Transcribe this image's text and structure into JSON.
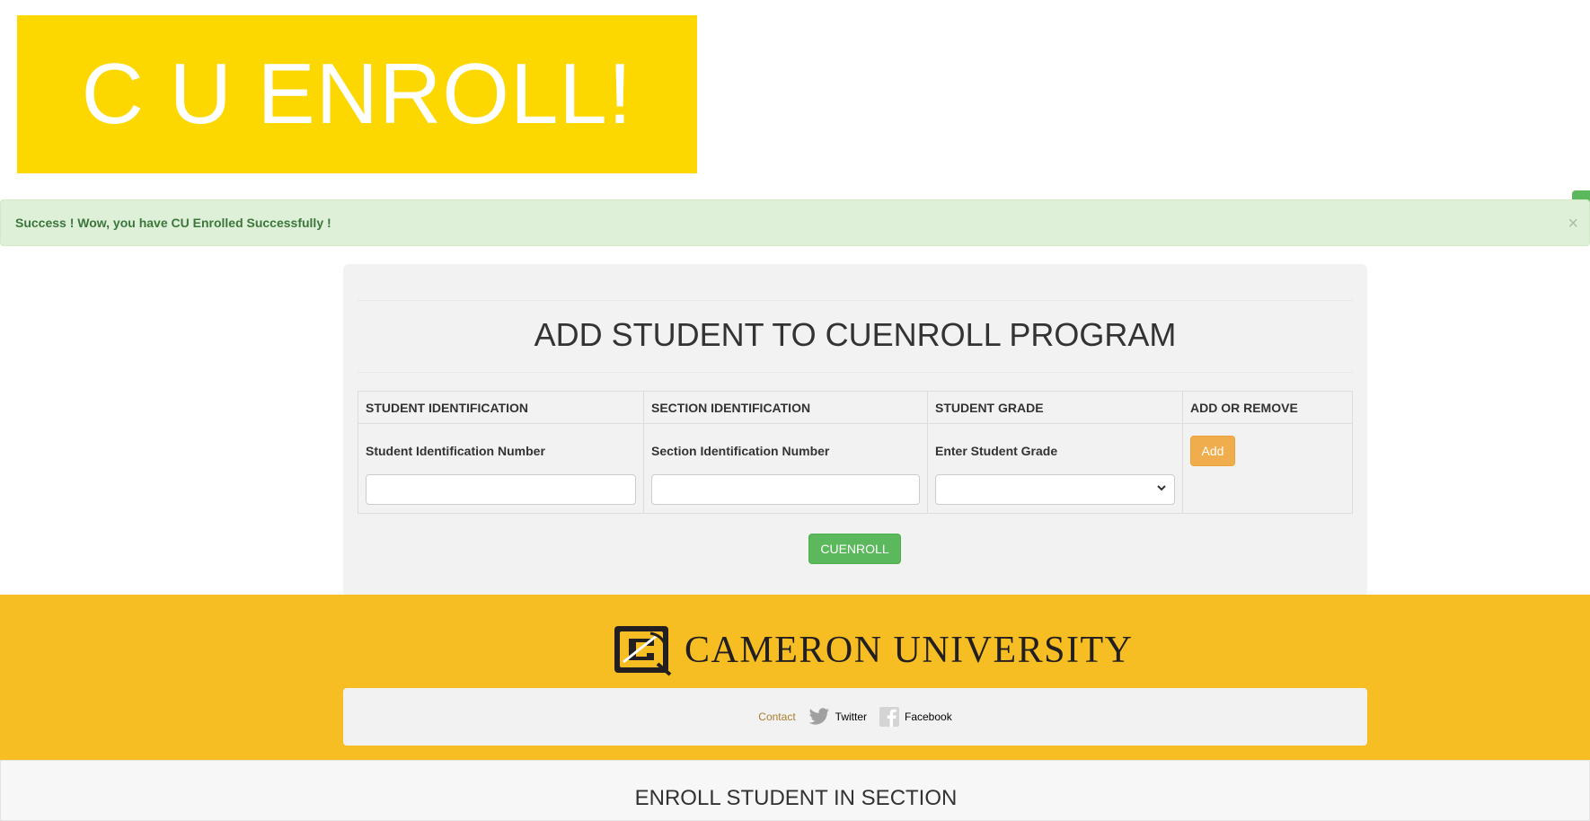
{
  "brand": {
    "title": "C U ENROLL!",
    "banner_color": "#fdd700"
  },
  "alert": {
    "message": "Success ! Wow, you have CU Enrolled Successfully !",
    "close": "×"
  },
  "form": {
    "title": "ADD STUDENT TO CUENROLL PROGRAM",
    "columns": [
      "STUDENT IDENTIFICATION",
      "SECTION IDENTIFICATION",
      "STUDENT GRADE",
      "ADD OR REMOVE"
    ],
    "student_label": "Student Identification Number",
    "student_value": "",
    "section_label": "Section Identification Number",
    "section_value": "",
    "grade_label": "Enter Student Grade",
    "grade_selected": "",
    "add_label": "Add",
    "submit_label": "CUENROLL"
  },
  "footer": {
    "university": "CAMERON UNIVERSITY",
    "links": {
      "contact": "Contact",
      "twitter": "Twitter",
      "facebook": "Facebook"
    },
    "colors": {
      "background": "#f6be22"
    }
  },
  "next_section": {
    "title": "ENROLL STUDENT IN SECTION"
  },
  "icons": {
    "twitter": "twitter-bird-icon",
    "facebook": "facebook-f-icon",
    "logo": "cameron-pickaxe-logo-icon"
  }
}
